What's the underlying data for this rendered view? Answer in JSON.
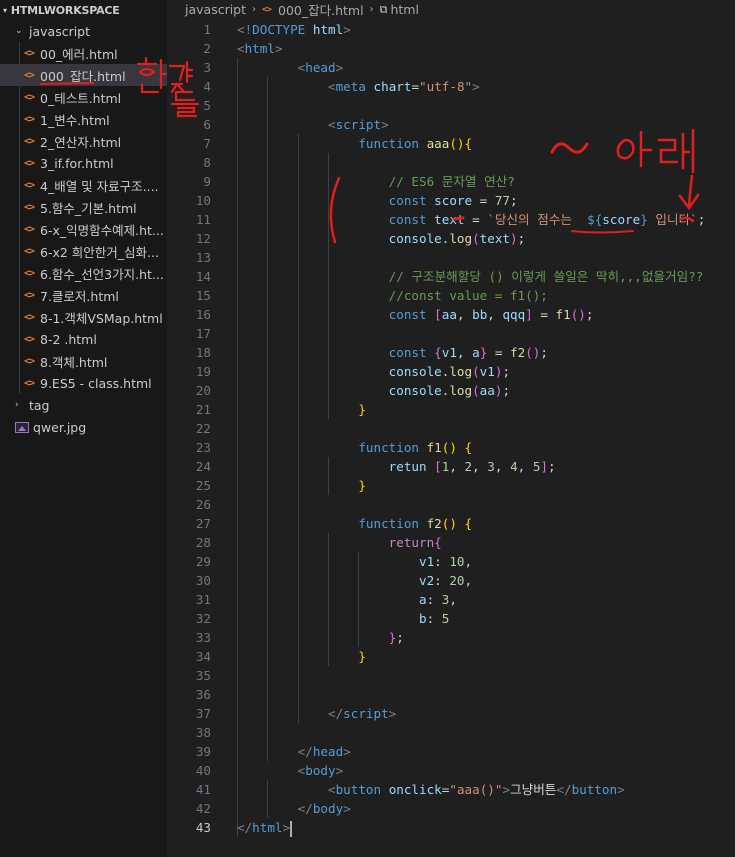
{
  "explorer": {
    "workspace_title": "HTMLWORKSPACE",
    "folders": [
      {
        "name": "javascript",
        "expanded": true
      },
      {
        "name": "tag",
        "expanded": false
      }
    ],
    "files": [
      "00_에러.html",
      "000_잡다.html",
      "0_테스트.html",
      "1_변수.html",
      "2_연산자.html",
      "3_if.for.html",
      "4_배열 및 자료구조....",
      "5.함수_기본.html",
      "6-x_익명함수예제.ht...",
      "6-x2 희안한거_심화...",
      "6.함수_선언3가지.ht...",
      "7.클로저.html",
      "8-1.객체VSMap.html",
      "8-2 .html",
      "8.객체.html",
      "9.ES5 - class.html"
    ],
    "selected_file_index": 1,
    "root_file": "qwer.jpg"
  },
  "breadcrumb": {
    "folder": "javascript",
    "file": "000_잡다.html",
    "symbol": "html"
  },
  "editor": {
    "active_line": 43,
    "line_numbers": [
      "1",
      "2",
      "3",
      "4",
      "5",
      "6",
      "7",
      "8",
      "9",
      "10",
      "11",
      "12",
      "13",
      "14",
      "15",
      "16",
      "17",
      "18",
      "19",
      "20",
      "21",
      "22",
      "23",
      "24",
      "25",
      "26",
      "27",
      "28",
      "29",
      "30",
      "31",
      "32",
      "33",
      "34",
      "35",
      "36",
      "37",
      "38",
      "39",
      "40",
      "41",
      "42",
      "43"
    ]
  },
  "colors": {
    "accent_red": "#e01f1f",
    "tag": "#569cd6",
    "string": "#ce9178",
    "comment": "#6a9955",
    "variable": "#9cdcfe",
    "function": "#dcdcaa",
    "html_icon": "#e37933"
  },
  "code_lines": [
    [
      [
        "t-pun",
        "<!"
      ],
      [
        "t-doc",
        "DOCTYPE"
      ],
      [
        "t-txt",
        " "
      ],
      [
        "t-dt",
        "html"
      ],
      [
        "t-pun",
        ">"
      ]
    ],
    [
      [
        "t-pun",
        "<"
      ],
      [
        "t-tag",
        "html"
      ],
      [
        "t-pun",
        ">"
      ]
    ],
    [
      [
        "t-txt",
        "        "
      ],
      [
        "t-pun",
        "<"
      ],
      [
        "t-tag",
        "head"
      ],
      [
        "t-pun",
        ">"
      ]
    ],
    [
      [
        "t-txt",
        "            "
      ],
      [
        "t-pun",
        "<"
      ],
      [
        "t-tag",
        "meta"
      ],
      [
        "t-txt",
        " "
      ],
      [
        "t-attr",
        "chart"
      ],
      [
        "t-txt",
        "="
      ],
      [
        "t-str",
        "\"utf-8\""
      ],
      [
        "t-pun",
        ">"
      ]
    ],
    [],
    [
      [
        "t-txt",
        "            "
      ],
      [
        "t-pun",
        "<"
      ],
      [
        "t-tag",
        "script"
      ],
      [
        "t-pun",
        ">"
      ]
    ],
    [
      [
        "t-txt",
        "                "
      ],
      [
        "t-kw",
        "function"
      ],
      [
        "t-txt",
        " "
      ],
      [
        "t-fn",
        "aaa"
      ],
      [
        "t-b1",
        "()"
      ],
      [
        "t-b1",
        "{"
      ]
    ],
    [],
    [
      [
        "t-txt",
        "                    "
      ],
      [
        "t-com",
        "// ES6 문자열 연산?"
      ]
    ],
    [
      [
        "t-txt",
        "                    "
      ],
      [
        "t-kw",
        "const"
      ],
      [
        "t-txt",
        " "
      ],
      [
        "t-var",
        "score"
      ],
      [
        "t-txt",
        " = "
      ],
      [
        "t-num",
        "77"
      ],
      [
        "t-txt",
        ";"
      ]
    ],
    [
      [
        "t-txt",
        "                    "
      ],
      [
        "t-kw",
        "const"
      ],
      [
        "t-txt",
        " "
      ],
      [
        "t-var",
        "text"
      ],
      [
        "t-txt",
        " = "
      ],
      [
        "t-str",
        "`당신의 점수는  "
      ],
      [
        "t-tpl",
        "${"
      ],
      [
        "t-var",
        "score"
      ],
      [
        "t-tpl",
        "}"
      ],
      [
        "t-str",
        " 입니다`"
      ],
      [
        "t-txt",
        ";"
      ]
    ],
    [
      [
        "t-txt",
        "                    "
      ],
      [
        "t-var",
        "console"
      ],
      [
        "t-txt",
        "."
      ],
      [
        "t-fn",
        "log"
      ],
      [
        "t-b2",
        "("
      ],
      [
        "t-var",
        "text"
      ],
      [
        "t-b2",
        ")"
      ],
      [
        "t-txt",
        ";"
      ]
    ],
    [],
    [
      [
        "t-txt",
        "                    "
      ],
      [
        "t-com",
        "// 구조분해할당 () 이렇게 쓸일은 딱히,,,없을거임??"
      ]
    ],
    [
      [
        "t-txt",
        "                    "
      ],
      [
        "t-com",
        "//const value = f1();"
      ]
    ],
    [
      [
        "t-txt",
        "                    "
      ],
      [
        "t-kw",
        "const"
      ],
      [
        "t-txt",
        " "
      ],
      [
        "t-b2",
        "["
      ],
      [
        "t-var",
        "aa"
      ],
      [
        "t-txt",
        ", "
      ],
      [
        "t-var",
        "bb"
      ],
      [
        "t-txt",
        ", "
      ],
      [
        "t-var",
        "qqq"
      ],
      [
        "t-b2",
        "]"
      ],
      [
        "t-txt",
        " = "
      ],
      [
        "t-fn",
        "f1"
      ],
      [
        "t-b2",
        "()"
      ],
      [
        "t-txt",
        ";"
      ]
    ],
    [],
    [
      [
        "t-txt",
        "                    "
      ],
      [
        "t-kw",
        "const"
      ],
      [
        "t-txt",
        " "
      ],
      [
        "t-b2",
        "{"
      ],
      [
        "t-var",
        "v1"
      ],
      [
        "t-txt",
        ", "
      ],
      [
        "t-var",
        "a"
      ],
      [
        "t-b2",
        "}"
      ],
      [
        "t-txt",
        " = "
      ],
      [
        "t-fn",
        "f2"
      ],
      [
        "t-b2",
        "()"
      ],
      [
        "t-txt",
        ";"
      ]
    ],
    [
      [
        "t-txt",
        "                    "
      ],
      [
        "t-var",
        "console"
      ],
      [
        "t-txt",
        "."
      ],
      [
        "t-fn",
        "log"
      ],
      [
        "t-b2",
        "("
      ],
      [
        "t-var",
        "v1"
      ],
      [
        "t-b2",
        ")"
      ],
      [
        "t-txt",
        ";"
      ]
    ],
    [
      [
        "t-txt",
        "                    "
      ],
      [
        "t-var",
        "console"
      ],
      [
        "t-txt",
        "."
      ],
      [
        "t-fn",
        "log"
      ],
      [
        "t-b2",
        "("
      ],
      [
        "t-var",
        "aa"
      ],
      [
        "t-b2",
        ")"
      ],
      [
        "t-txt",
        ";"
      ]
    ],
    [
      [
        "t-txt",
        "                "
      ],
      [
        "t-b1",
        "}"
      ]
    ],
    [],
    [
      [
        "t-txt",
        "                "
      ],
      [
        "t-kw",
        "function"
      ],
      [
        "t-txt",
        " "
      ],
      [
        "t-fn",
        "f1"
      ],
      [
        "t-b1",
        "()"
      ],
      [
        "t-txt",
        " "
      ],
      [
        "t-b1",
        "{"
      ]
    ],
    [
      [
        "t-txt",
        "                    "
      ],
      [
        "t-var",
        "retun"
      ],
      [
        "t-txt",
        " "
      ],
      [
        "t-b2",
        "["
      ],
      [
        "t-num",
        "1"
      ],
      [
        "t-txt",
        ", "
      ],
      [
        "t-num",
        "2"
      ],
      [
        "t-txt",
        ", "
      ],
      [
        "t-num",
        "3"
      ],
      [
        "t-txt",
        ", "
      ],
      [
        "t-num",
        "4"
      ],
      [
        "t-txt",
        ", "
      ],
      [
        "t-num",
        "5"
      ],
      [
        "t-b2",
        "]"
      ],
      [
        "t-txt",
        ";"
      ]
    ],
    [
      [
        "t-txt",
        "                "
      ],
      [
        "t-b1",
        "}"
      ]
    ],
    [],
    [
      [
        "t-txt",
        "                "
      ],
      [
        "t-kw",
        "function"
      ],
      [
        "t-txt",
        " "
      ],
      [
        "t-fn",
        "f2"
      ],
      [
        "t-b1",
        "()"
      ],
      [
        "t-txt",
        " "
      ],
      [
        "t-b1",
        "{"
      ]
    ],
    [
      [
        "t-txt",
        "                    "
      ],
      [
        "t-ctl",
        "return"
      ],
      [
        "t-b2",
        "{"
      ]
    ],
    [
      [
        "t-txt",
        "                        "
      ],
      [
        "t-var",
        "v1"
      ],
      [
        "t-txt",
        ": "
      ],
      [
        "t-num",
        "10"
      ],
      [
        "t-txt",
        ","
      ]
    ],
    [
      [
        "t-txt",
        "                        "
      ],
      [
        "t-var",
        "v2"
      ],
      [
        "t-txt",
        ": "
      ],
      [
        "t-num",
        "20"
      ],
      [
        "t-txt",
        ","
      ]
    ],
    [
      [
        "t-txt",
        "                        "
      ],
      [
        "t-var",
        "a"
      ],
      [
        "t-txt",
        ": "
      ],
      [
        "t-num",
        "3"
      ],
      [
        "t-txt",
        ","
      ]
    ],
    [
      [
        "t-txt",
        "                        "
      ],
      [
        "t-var",
        "b"
      ],
      [
        "t-txt",
        ": "
      ],
      [
        "t-num",
        "5"
      ]
    ],
    [
      [
        "t-txt",
        "                    "
      ],
      [
        "t-b2",
        "}"
      ],
      [
        "t-txt",
        ";"
      ]
    ],
    [
      [
        "t-txt",
        "                "
      ],
      [
        "t-b1",
        "}"
      ]
    ],
    [],
    [],
    [
      [
        "t-txt",
        "            "
      ],
      [
        "t-pun",
        "</"
      ],
      [
        "t-tag",
        "script"
      ],
      [
        "t-pun",
        ">"
      ]
    ],
    [],
    [
      [
        "t-txt",
        "        "
      ],
      [
        "t-pun",
        "</"
      ],
      [
        "t-tag",
        "head"
      ],
      [
        "t-pun",
        ">"
      ]
    ],
    [
      [
        "t-txt",
        "        "
      ],
      [
        "t-pun",
        "<"
      ],
      [
        "t-tag",
        "body"
      ],
      [
        "t-pun",
        ">"
      ]
    ],
    [
      [
        "t-txt",
        "            "
      ],
      [
        "t-pun",
        "<"
      ],
      [
        "t-tag",
        "button"
      ],
      [
        "t-txt",
        " "
      ],
      [
        "t-attr",
        "onclick"
      ],
      [
        "t-txt",
        "="
      ],
      [
        "t-str",
        "\"aaa()\""
      ],
      [
        "t-pun",
        ">"
      ],
      [
        "t-txt",
        "그냥버튼"
      ],
      [
        "t-pun",
        "</"
      ],
      [
        "t-tag",
        "button"
      ],
      [
        "t-pun",
        ">"
      ]
    ],
    [
      [
        "t-txt",
        "        "
      ],
      [
        "t-pun",
        "</"
      ],
      [
        "t-tag",
        "body"
      ],
      [
        "t-pun",
        ">"
      ]
    ],
    [
      [
        "t-pun",
        "</"
      ],
      [
        "t-tag",
        "html"
      ],
      [
        "t-pun",
        ">"
      ]
    ]
  ]
}
